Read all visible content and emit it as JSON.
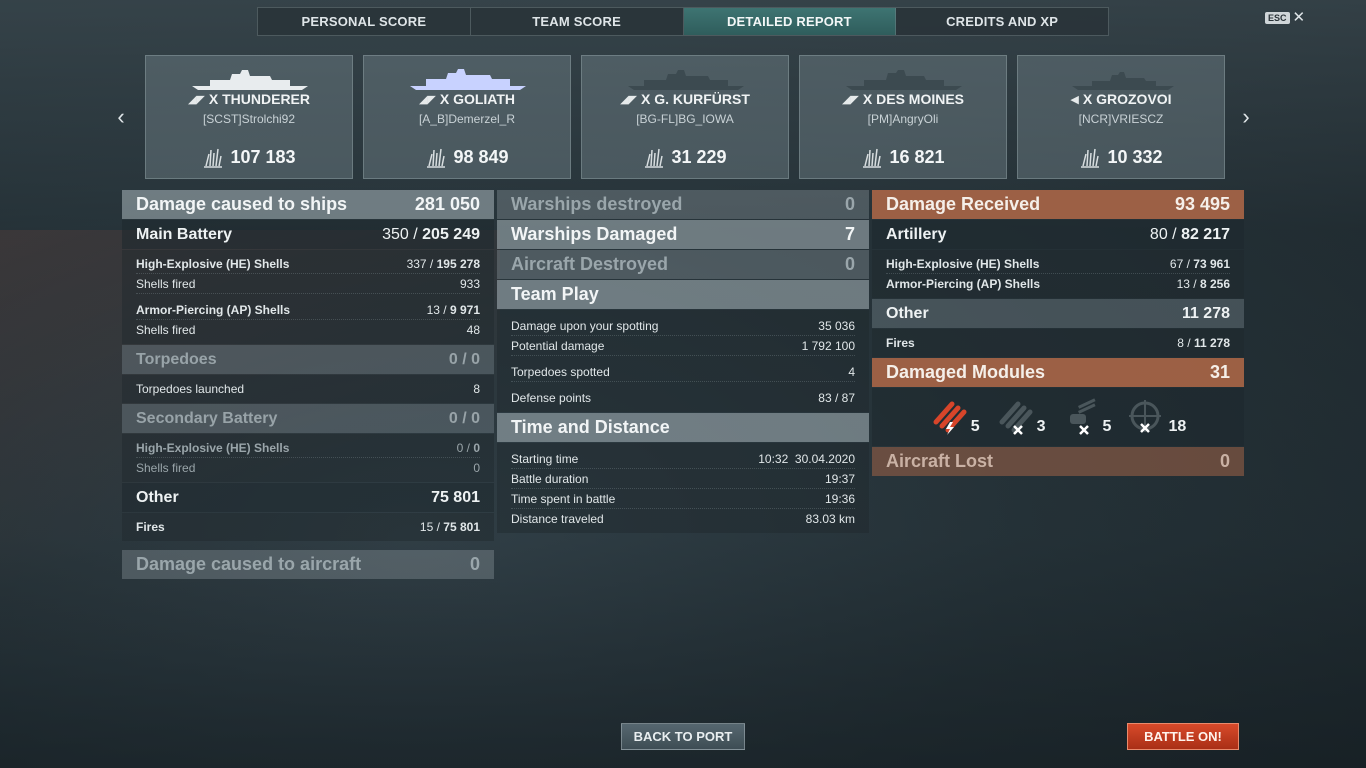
{
  "tabs": [
    "PERSONAL SCORE",
    "TEAM SCORE",
    "DETAILED REPORT",
    "CREDITS AND XP"
  ],
  "esc": {
    "key": "ESC",
    "close": "✕"
  },
  "nav": {
    "prev": "‹",
    "next": "›"
  },
  "ships": [
    {
      "name": "X THUNDERER",
      "player": "[SCST]Strolchi92",
      "damage": "107 183",
      "class_icon": "battleship-icon"
    },
    {
      "name": "X GOLIATH",
      "player": "[A_B]Demerzel_R",
      "damage": "98 849",
      "class_icon": "battleship-icon"
    },
    {
      "name": "X G. KURFÜRST",
      "player": "[BG-FL]BG_IOWA",
      "damage": "31 229",
      "class_icon": "battleship-icon"
    },
    {
      "name": "X DES MOINES",
      "player": "[PM]AngryOli",
      "damage": "16 821",
      "class_icon": "cruiser-icon"
    },
    {
      "name": "X GROZOVOI",
      "player": "[NCR]VRIESCZ",
      "damage": "10 332",
      "class_icon": "destroyer-icon"
    }
  ],
  "col1": {
    "damage_ships": {
      "label": "Damage caused to ships",
      "value": "281 050"
    },
    "main_battery": {
      "label": "Main Battery",
      "hits": "350",
      "sep": " / ",
      "damage": "205 249"
    },
    "he": {
      "label": "High-Explosive (HE) Shells",
      "hits": "337",
      "damage": "195 278"
    },
    "he_fired": {
      "label": "Shells fired",
      "value": "933"
    },
    "ap": {
      "label": "Armor-Piercing (AP) Shells",
      "hits": "13",
      "damage": "9 971"
    },
    "ap_fired": {
      "label": "Shells fired",
      "value": "48"
    },
    "torpedoes": {
      "label": "Torpedoes",
      "value": "0 / 0"
    },
    "torp_launched": {
      "label": "Torpedoes launched",
      "value": "8"
    },
    "secondary": {
      "label": "Secondary Battery",
      "value": "0 / 0"
    },
    "sec_he": {
      "label": "High-Explosive (HE) Shells",
      "hits": "0",
      "damage": "0"
    },
    "sec_fired": {
      "label": "Shells fired",
      "value": "0"
    },
    "other": {
      "label": "Other",
      "value": "75 801"
    },
    "fires": {
      "label": "Fires",
      "hits": "15",
      "damage": "75 801"
    },
    "damage_aircraft": {
      "label": "Damage caused to aircraft",
      "value": "0"
    }
  },
  "col2": {
    "destroyed": {
      "label": "Warships destroyed",
      "value": "0"
    },
    "damaged": {
      "label": "Warships Damaged",
      "value": "7"
    },
    "aircraft": {
      "label": "Aircraft Destroyed",
      "value": "0"
    },
    "teamplay": {
      "label": "Team Play"
    },
    "spotting": {
      "label": "Damage upon your spotting",
      "value": "35 036"
    },
    "potential": {
      "label": "Potential damage",
      "value": "1 792 100"
    },
    "torp_spotted": {
      "label": "Torpedoes spotted",
      "value": "4"
    },
    "defense": {
      "label": "Defense points",
      "value": "83 / 87"
    },
    "time": {
      "label": "Time and Distance"
    },
    "start": {
      "label": "Starting time",
      "value": "10:32  30.04.2020"
    },
    "duration": {
      "label": "Battle duration",
      "value": "19:37"
    },
    "spent": {
      "label": "Time spent in battle",
      "value": "19:36"
    },
    "distance": {
      "label": "Distance traveled",
      "value": "83.03 km"
    }
  },
  "col3": {
    "received": {
      "label": "Damage Received",
      "value": "93 495"
    },
    "artillery": {
      "label": "Artillery",
      "hits": "80",
      "damage": "82 217"
    },
    "he": {
      "label": "High-Explosive (HE) Shells",
      "hits": "67",
      "damage": "73 961"
    },
    "ap": {
      "label": "Armor-Piercing (AP) Shells",
      "hits": "13",
      "damage": "8 256"
    },
    "other": {
      "label": "Other",
      "value": "11 278"
    },
    "fires": {
      "label": "Fires",
      "hits": "8",
      "damage": "11 278"
    },
    "modules": {
      "label": "Damaged Modules",
      "value": "31"
    },
    "module_counts": [
      {
        "icon": "torpedo-tubes-damaged-icon",
        "count": "5"
      },
      {
        "icon": "torpedo-tubes-destroyed-icon",
        "count": "3"
      },
      {
        "icon": "secondary-gun-destroyed-icon",
        "count": "5"
      },
      {
        "icon": "aa-gun-destroyed-icon",
        "count": "18"
      }
    ],
    "aircraft_lost": {
      "label": "Aircraft Lost",
      "value": "0"
    }
  },
  "buttons": {
    "back": "BACK TO PORT",
    "battle": "BATTLE ON!"
  },
  "colors": {
    "accent_tab": "#3e7472",
    "received": "#b26848",
    "battle": "#c93c1f"
  }
}
